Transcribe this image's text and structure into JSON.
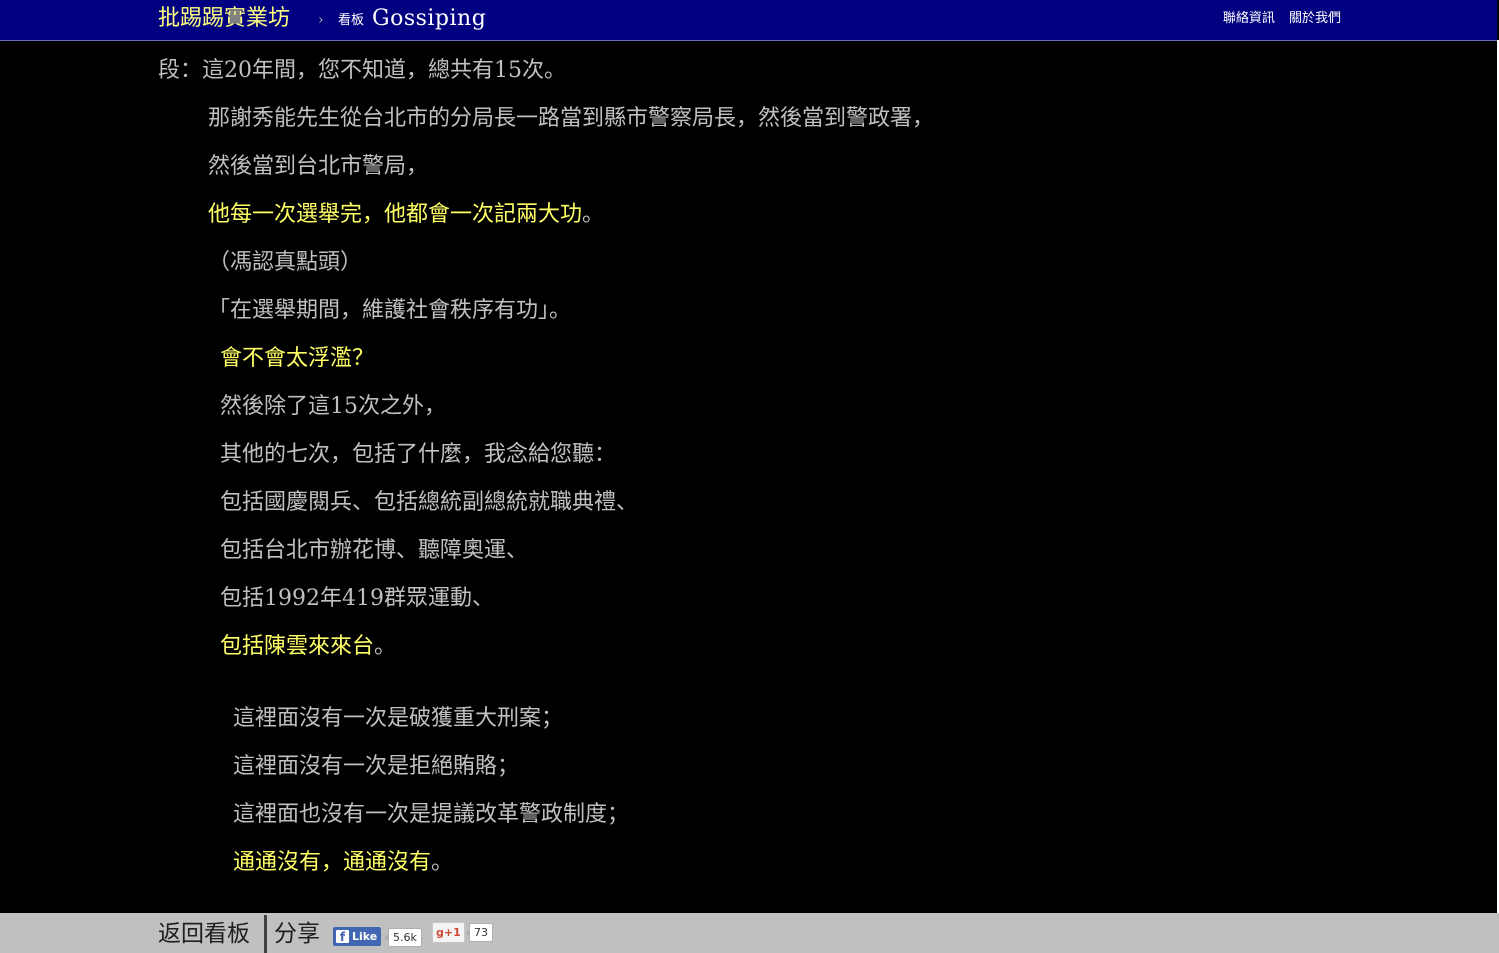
{
  "header": {
    "site_title": "批踢踢實業坊",
    "breadcrumb_separator": "›",
    "board_prefix": "看板",
    "board_name": "Gossiping",
    "links": [
      "聯絡資訊",
      "關於我們"
    ]
  },
  "article": {
    "lines": [
      {
        "segments": [
          {
            "text": "段：這20年間，您不知道，總共有15次。",
            "highlight": false
          }
        ]
      },
      {
        "segments": [
          {
            "text": "那謝秀能先生從台北市的分局長一路當到縣市警察局長，然後當到警政署，",
            "highlight": false
          }
        ]
      },
      {
        "segments": [
          {
            "text": "然後當到台北市警局，",
            "highlight": false
          }
        ]
      },
      {
        "segments": [
          {
            "text": "他每一次選舉完，他都會一次記兩大功",
            "highlight": true
          },
          {
            "text": "。",
            "highlight": false
          }
        ]
      },
      {
        "segments": [
          {
            "text": "（馮認真點頭）",
            "highlight": false
          }
        ]
      },
      {
        "segments": [
          {
            "text": "「在選舉期間，維護社會秩序有功」。",
            "highlight": false
          }
        ]
      },
      {
        "segments": [
          {
            "text": "會不會太浮濫？",
            "highlight": true
          }
        ]
      },
      {
        "segments": [
          {
            "text": "然後除了這15次之外，",
            "highlight": false
          }
        ]
      },
      {
        "segments": [
          {
            "text": "其他的七次，包括了什麼，我念給您聽：",
            "highlight": false
          }
        ]
      },
      {
        "segments": [
          {
            "text": "包括國慶閱兵、包括總統副總統就職典禮、",
            "highlight": false
          }
        ]
      },
      {
        "segments": [
          {
            "text": "包括台北市辦花博、聽障奧運、",
            "highlight": false
          }
        ]
      },
      {
        "segments": [
          {
            "text": "包括1992年419群眾運動、",
            "highlight": false
          }
        ]
      },
      {
        "segments": [
          {
            "text": "包括陳雲來來台",
            "highlight": true
          },
          {
            "text": "。",
            "highlight": false
          }
        ]
      },
      {
        "segments": [
          {
            "text": "這裡面沒有一次是破獲重大刑案；",
            "highlight": false
          }
        ]
      },
      {
        "segments": [
          {
            "text": "這裡面沒有一次是拒絕賄賂；",
            "highlight": false
          }
        ]
      },
      {
        "segments": [
          {
            "text": "這裡面也沒有一次是提議改革警政制度；",
            "highlight": false
          }
        ]
      },
      {
        "segments": [
          {
            "text": "通通沒有，通通沒有",
            "highlight": true
          },
          {
            "text": "。",
            "highlight": false
          }
        ]
      }
    ]
  },
  "footer": {
    "back_label": "返回看板",
    "share_label": "分享",
    "fb_logo": "f",
    "fb_like_label": "Like",
    "fb_count": "5.6k",
    "gplus_label": "g+1",
    "gplus_count": "73"
  },
  "colors": {
    "header_bg": "#000080",
    "site_title": "#ffff80",
    "text_normal": "#c0c0c0",
    "text_highlight": "#ffff66",
    "footer_bg": "#c0c0c0"
  }
}
